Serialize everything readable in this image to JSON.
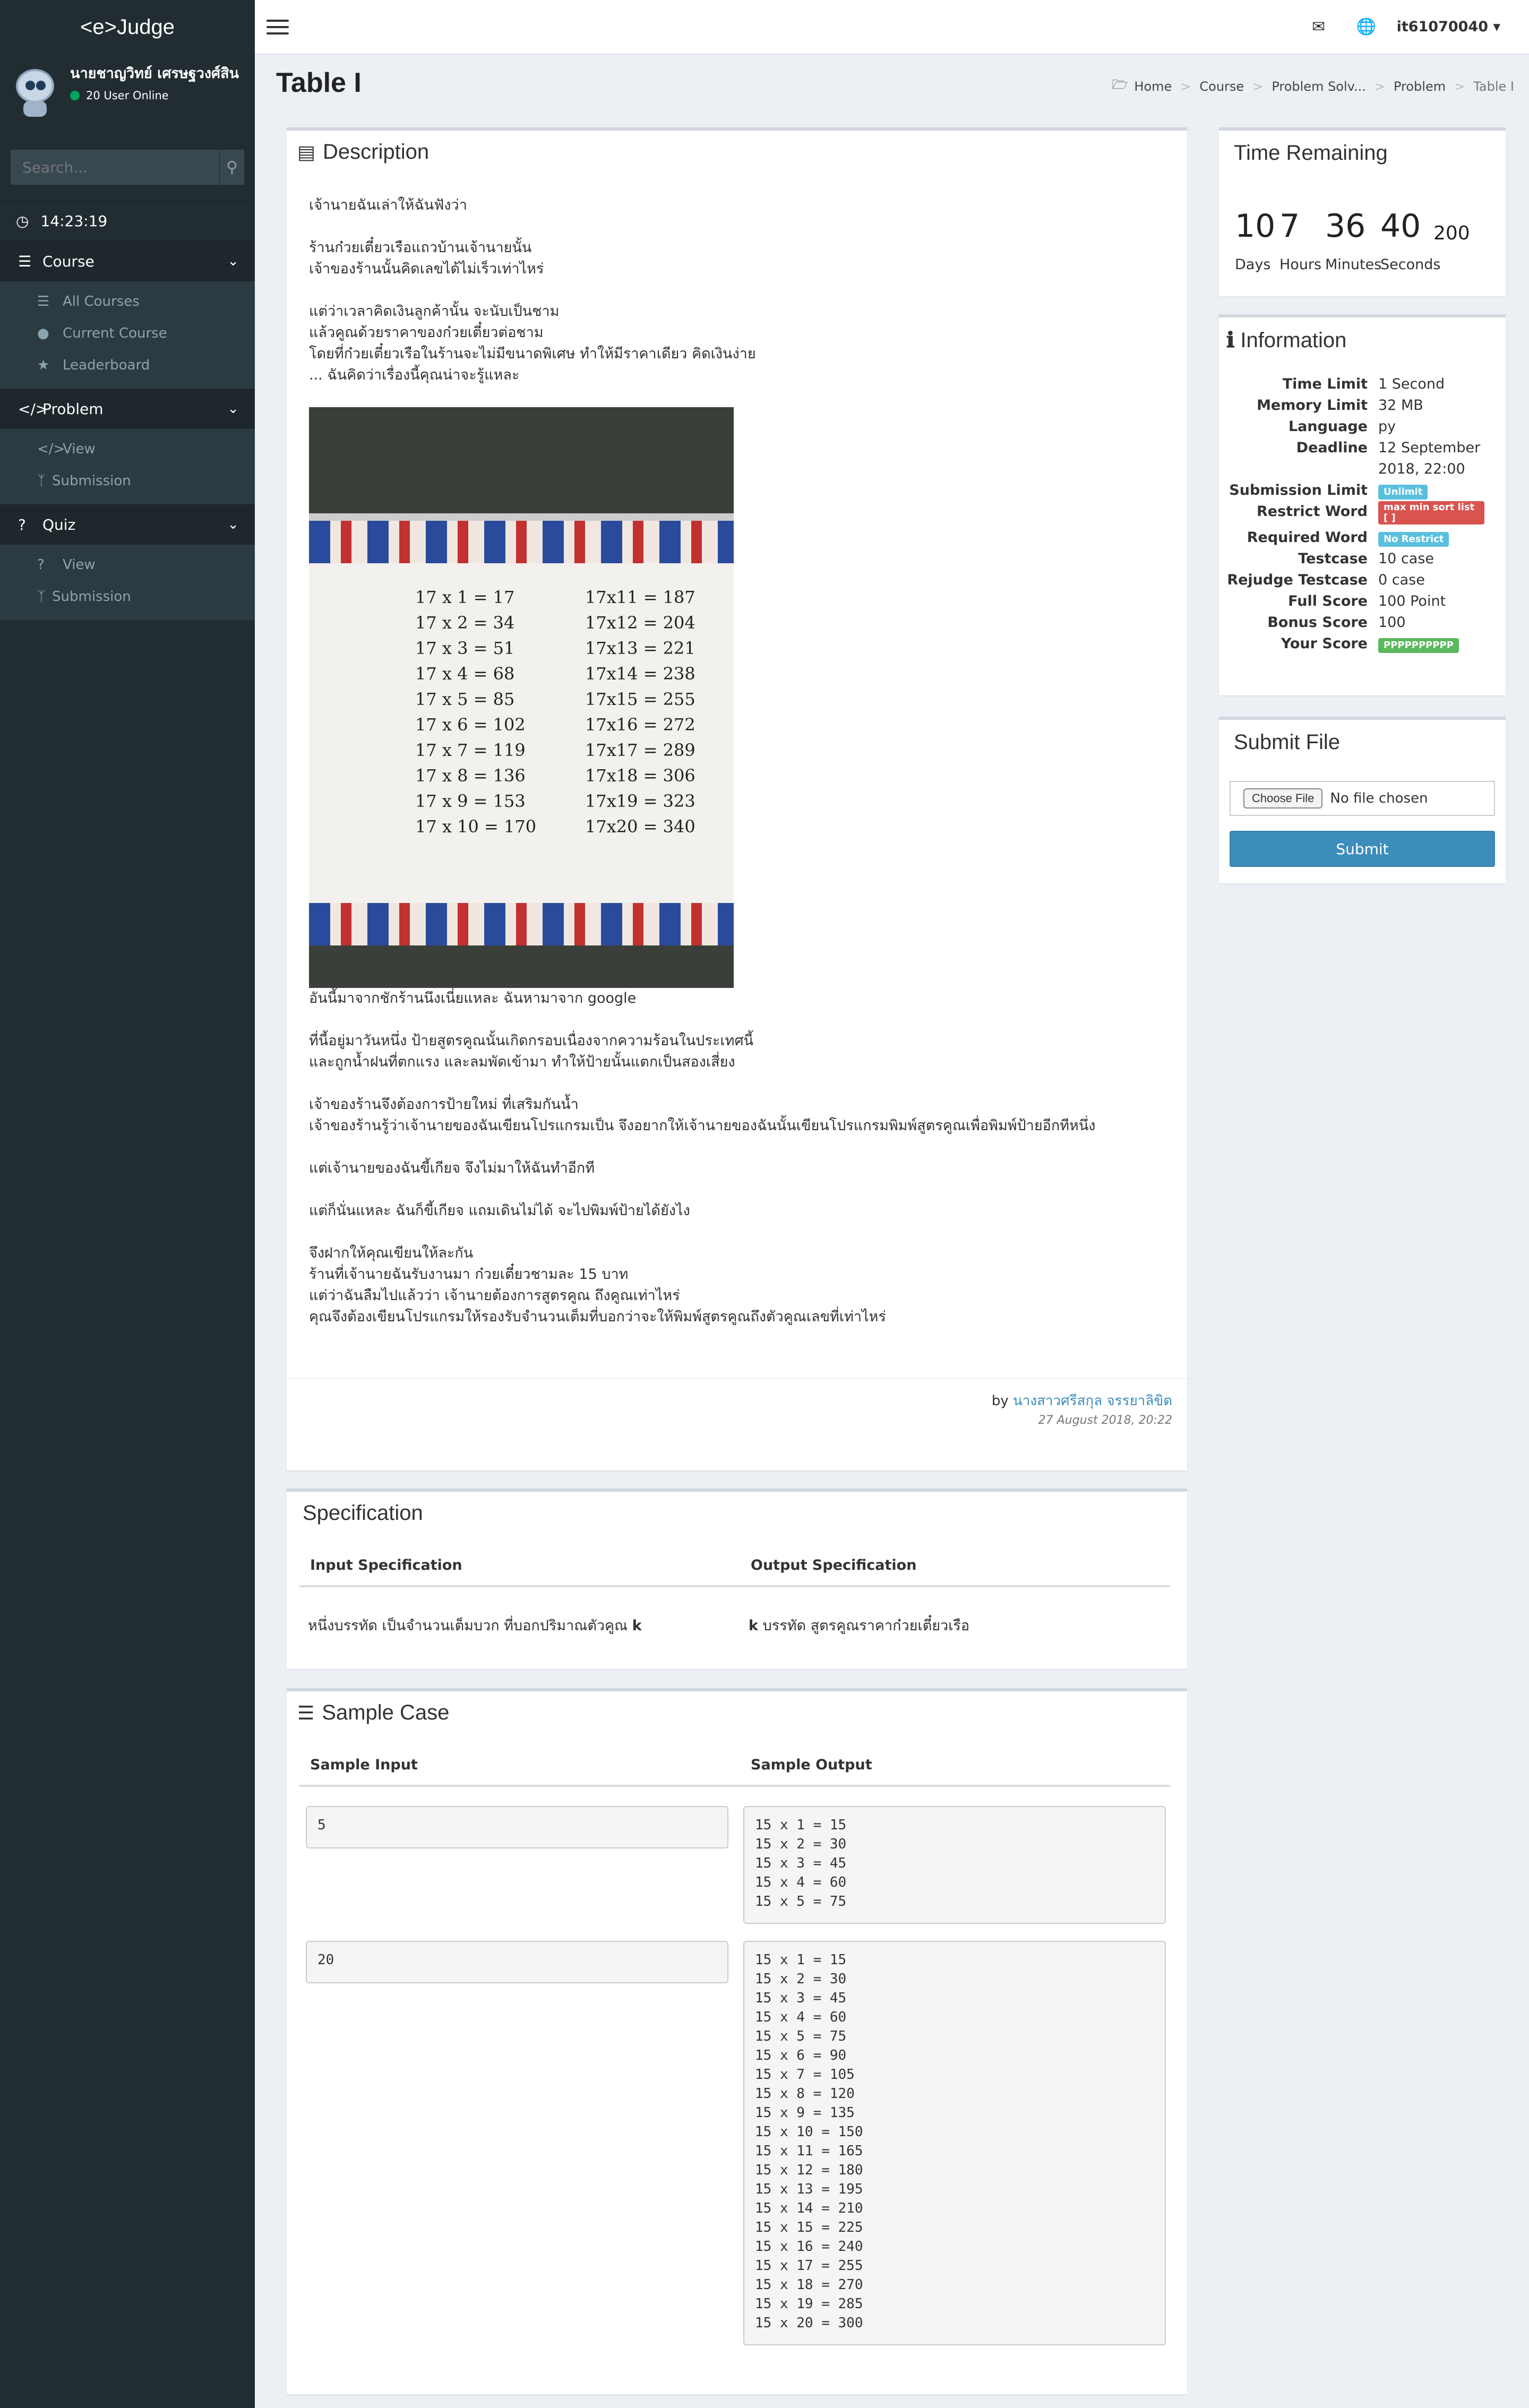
{
  "app": {
    "logo": "<e>Judge"
  },
  "user": {
    "name": "นายชาญวิทย์ เศรษฐวงศ์สิน",
    "online": "20 User Online",
    "account": "it61070040"
  },
  "search": {
    "placeholder": "Search..."
  },
  "clock": "14:23:19",
  "menu": {
    "course": {
      "label": "Course",
      "items": [
        "All Courses",
        "Current Course",
        "Leaderboard"
      ]
    },
    "problem": {
      "label": "Problem",
      "items": [
        "View",
        "Submission"
      ]
    },
    "quiz": {
      "label": "Quiz",
      "items": [
        "View",
        "Submission"
      ]
    }
  },
  "page": {
    "title": "Table I"
  },
  "breadcrumb": [
    "Home",
    "Course",
    "Problem Solv...",
    "Problem",
    "Table I"
  ],
  "description": {
    "title": "Description",
    "paragraphs": [
      "เจ้านายฉันเล่าให้ฉันฟังว่า",
      "ร้านก๋วยเตี๋ยวเรือแถวบ้านเจ้านายนั้น\nเจ้าของร้านนั้นคิดเลขได้ไม่เร็วเท่าไหร่",
      "แต่ว่าเวลาคิดเงินลูกค้านั้น จะนับเป็นชาม\nแล้วคูณด้วยราคาของก๋วยเตี๋ยวต่อชาม\nโดยที่ก๋วยเตี๋ยวเรือในร้านจะไม่มีขนาดพิเศษ ทำให้มีราคาเดียว คิดเงินง่าย\n... ฉันคิดว่าเรื่องนี้คุณน่าจะรู้แหละ"
    ],
    "image_caption": "อันนี้มาจากชักร้านนึงเนี่ยแหละ ฉันหามาจาก google",
    "paragraphs2": [
      "ที่นี้อยู่มาวันหนึ่ง ป้ายสูตรคูณนั้นเกิดกรอบเนื่องจากความร้อนในประเทศนี้\nและถูกน้ำฝนที่ตกแรง และลมพัดเข้ามา ทำให้ป้ายนั้นแตกเป็นสองเสี่ยง",
      "เจ้าของร้านจึงต้องการป้ายใหม่ ที่เสริมกันน้ำ\nเจ้าของร้านรู้ว่าเจ้านายของฉันเขียนโปรแกรมเป็น จึงอยากให้เจ้านายของฉันนั้นเขียนโปรแกรมพิมพ์สูตรคูณเพื่อพิมพ์ป้ายอีกทีหนึ่ง",
      "แต่เจ้านายของฉันขี้เกียจ จึงไม่มาให้ฉันทำอีกที",
      "แต่ก็นั่นแหละ ฉันก็ขี้เกียจ แถมเดินไม่ได้ จะไปพิมพ์ป้ายได้ยังไง",
      "จึงฝากให้คุณเขียนให้ละกัน\nร้านที่เจ้านายฉันรับงานมา ก๋วยเตี๋ยวชามละ 15 บาท\nแต่ว่าฉันลืมไปแล้วว่า เจ้านายต้องการสูตรคูณ ถึงคูณเท่าไหร่\nคุณจึงต้องเขียนโปรแกรมให้รองรับจำนวนเต็มที่บอกว่าจะให้พิมพ์สูตรคูณถึงตัวคูณเลขที่เท่าไหร่"
    ],
    "author_prefix": "by",
    "author": "นางสาวศรีสกุล จรรยาลิขิต",
    "date": "27 August 2018, 20:22"
  },
  "banner": {
    "left": [
      "17 x 1 = 17",
      "17 x 2 = 34",
      "17 x 3 = 51",
      "17 x 4 = 68",
      "17 x 5 = 85",
      "17 x 6 = 102",
      "17 x 7 = 119",
      "17 x 8 = 136",
      "17 x 9 = 153",
      "17 x 10 = 170"
    ],
    "right": [
      "17x11 = 187",
      "17x12 = 204",
      "17x13 = 221",
      "17x14 = 238",
      "17x15 = 255",
      "17x16 = 272",
      "17x17 = 289",
      "17x18 = 306",
      "17x19 = 323",
      "17x20 = 340"
    ]
  },
  "specification": {
    "title": "Specification",
    "input_header": "Input Specification",
    "output_header": "Output Specification",
    "input": "หนึ่งบรรทัด เป็นจำนวนเต็มบวก ที่บอกปริมาณตัวคูณ",
    "input_var": "k",
    "output_var": "k",
    "output": "บรรทัด สูตรคูณราคาก๋วยเตี๋ยวเรือ"
  },
  "sample": {
    "title": "Sample Case",
    "input_header": "Sample Input",
    "output_header": "Sample Output",
    "cases": [
      {
        "input": "5",
        "output": "15 x 1 = 15\n15 x 2 = 30\n15 x 3 = 45\n15 x 4 = 60\n15 x 5 = 75"
      },
      {
        "input": "20",
        "output": "15 x 1 = 15\n15 x 2 = 30\n15 x 3 = 45\n15 x 4 = 60\n15 x 5 = 75\n15 x 6 = 90\n15 x 7 = 105\n15 x 8 = 120\n15 x 9 = 135\n15 x 10 = 150\n15 x 11 = 165\n15 x 12 = 180\n15 x 13 = 195\n15 x 14 = 210\n15 x 15 = 225\n15 x 16 = 240\n15 x 17 = 255\n15 x 18 = 270\n15 x 19 = 285\n15 x 20 = 300"
      }
    ]
  },
  "time_remaining": {
    "title": "Time Remaining",
    "days": "10",
    "hours": "7",
    "minutes": "36",
    "seconds": "40",
    "ms": "200",
    "days_label": "Days",
    "hours_label": "Hours",
    "minutes_label": "Minutes",
    "seconds_label": "Seconds"
  },
  "information": {
    "title": "Information",
    "time_limit_key": "Time Limit",
    "time_limit": "1 Second",
    "memory_limit_key": "Memory Limit",
    "memory_limit": "32 MB",
    "language_key": "Language",
    "language": "py",
    "deadline_key": "Deadline",
    "deadline": "12 September 2018, 22:00",
    "submission_limit_key": "Submission Limit",
    "submission_limit": "Unlimit",
    "restrict_word_key": "Restrict Word",
    "restrict_word": "max min sort list [ ]",
    "required_word_key": "Required Word",
    "required_word": "No Restrict",
    "testcase_key": "Testcase",
    "testcase": "10 case",
    "rejudge_key": "Rejudge Testcase",
    "rejudge": "0 case",
    "full_score_key": "Full Score",
    "full_score": "100 Point",
    "bonus_score_key": "Bonus Score",
    "bonus_score": "100",
    "your_score_key": "Your Score",
    "your_score": "PPPPPPPPPP"
  },
  "submit": {
    "title": "Submit File",
    "choose": "Choose File",
    "no_file": "No file chosen",
    "button": "Submit"
  },
  "colors": {
    "sidebar": "#222d32",
    "accent": "#3c8dbc",
    "online": "#00a65a"
  },
  "icons": {
    "search": "search-icon",
    "clock": "clock-icon",
    "course": "list-icon",
    "problem": "code-icon",
    "quiz": "question-icon",
    "mail": "envelope-icon",
    "globe": "globe-icon",
    "description": "list-alt-icon",
    "info": "info-icon",
    "sample": "list-ol-icon"
  }
}
